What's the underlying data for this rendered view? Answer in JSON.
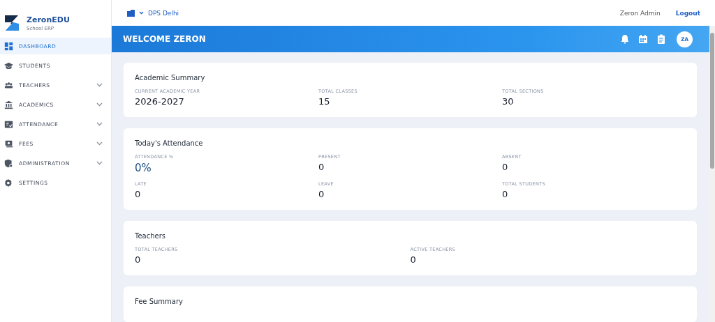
{
  "brand": {
    "name": "ZeronEDU",
    "subtitle": "School ERP"
  },
  "sidebar": {
    "items": [
      {
        "label": "DASHBOARD",
        "selected": true,
        "expandable": false
      },
      {
        "label": "STUDENTS",
        "selected": false,
        "expandable": false
      },
      {
        "label": "TEACHERS",
        "selected": false,
        "expandable": true
      },
      {
        "label": "ACADEMICS",
        "selected": false,
        "expandable": true
      },
      {
        "label": "ATTENDANCE",
        "selected": false,
        "expandable": true
      },
      {
        "label": "FEES",
        "selected": false,
        "expandable": true
      },
      {
        "label": "ADMINISTRATION",
        "selected": false,
        "expandable": true
      },
      {
        "label": "SETTINGS",
        "selected": false,
        "expandable": false
      }
    ]
  },
  "topbar": {
    "school": "DPS Delhi",
    "user": "Zeron Admin",
    "logout": "Logout"
  },
  "banner": {
    "title": "WELCOME ZERON",
    "avatar": "ZA"
  },
  "cards": [
    {
      "title": "Academic Summary",
      "stats": [
        {
          "label": "CURRENT ACADEMIC YEAR",
          "value": "2026-2027"
        },
        {
          "label": "TOTAL CLASSES",
          "value": "15"
        },
        {
          "label": "TOTAL SECTIONS",
          "value": "30"
        }
      ]
    },
    {
      "title": "Today's Attendance",
      "stats": [
        {
          "label": "ATTENDANCE %",
          "value": "0%",
          "highlight": true
        },
        {
          "label": "PRESENT",
          "value": "0"
        },
        {
          "label": "ABSENT",
          "value": "0"
        },
        {
          "label": "LATE",
          "value": "0"
        },
        {
          "label": "LEAVE",
          "value": "0"
        },
        {
          "label": "TOTAL STUDENTS",
          "value": "0"
        }
      ]
    },
    {
      "title": "Teachers",
      "stats": [
        {
          "label": "TOTAL TEACHERS",
          "value": "0"
        },
        {
          "label": "ACTIVE TEACHERS",
          "value": "0"
        }
      ]
    },
    {
      "title": "Fee Summary"
    }
  ]
}
